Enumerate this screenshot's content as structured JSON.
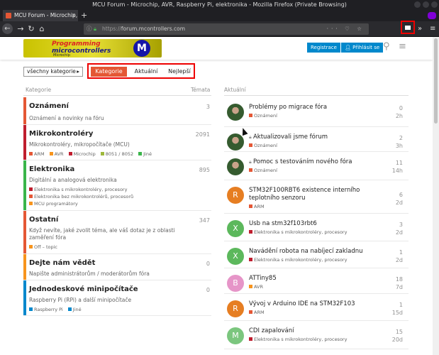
{
  "browser": {
    "window_title": "MCU Forum - Microchip, AVR, Raspberry Pi, elektronika - Mozilla Firefox (Private Browsing)",
    "tab_title": "MCU Forum - Microchip, AVR, R",
    "url_prefix": "https://",
    "url_host": "forum.mcontrollers.com",
    "new_tab": "+",
    "icons": {
      "back": "arrow-left-icon",
      "forward": "arrow-right-icon",
      "reload": "reload-icon",
      "home": "home-icon",
      "lock": "lock-icon",
      "extension": "extension-icon",
      "menu": "hamburger-icon"
    }
  },
  "header": {
    "logo_line1": "Programming",
    "logo_line2": "microcontrollers",
    "logo_small": "Microchip",
    "logo_m": "M",
    "register": "Registrace",
    "login": "Přihlásit se"
  },
  "nav": {
    "dropdown": "všechny kategorie",
    "pills": [
      "Kategorie",
      "Aktuální",
      "Nejlepší"
    ],
    "active": "Kategorie"
  },
  "columns": {
    "categories": "Kategorie",
    "topics": "Témata",
    "latest": "Aktuální"
  },
  "categories": [
    {
      "name": "Oznámení",
      "count": "3",
      "color": "#e45735",
      "desc": "Oznámení a novinky na fóru",
      "subs": []
    },
    {
      "name": "Mikrokontroléry",
      "count": "2091",
      "color": "#bf1e2e",
      "desc": "Mikrokontroléry, mikropočítače (MCU)",
      "subs": [
        {
          "n": "ARM",
          "c": "#e45735"
        },
        {
          "n": "AVR",
          "c": "#f7941d"
        },
        {
          "n": "Microchip",
          "c": "#bf1e2e"
        },
        {
          "n": "8051 / 8052",
          "c": "#9eb83b"
        },
        {
          "n": "Jiné",
          "c": "#3ab54a"
        }
      ]
    },
    {
      "name": "Elektronika",
      "count": "895",
      "color": "#3ab54a",
      "desc": "Digitální a analogová elektronika",
      "subs": [
        {
          "n": "Elektronika s mikrokontroléry, procesory",
          "c": "#bf1e2e"
        },
        {
          "n": "Elektronika bez mikrokontrolérů, procesorů",
          "c": "#e45735"
        },
        {
          "n": "MCU programátory",
          "c": "#f7941d"
        }
      ]
    },
    {
      "name": "Ostatní",
      "count": "347",
      "color": "#e45735",
      "desc": "Když nevíte, jaké zvolit téma, ale váš dotaz je z oblasti zaměření fóra",
      "subs": [
        {
          "n": "Off – topic",
          "c": "#f7941d"
        }
      ]
    },
    {
      "name": "Dejte nám vědět",
      "count": "0",
      "color": "#f7941d",
      "desc": "Napište administrátorům / moderátorům fóra",
      "subs": []
    },
    {
      "name": "Jednodeskové minipočítače",
      "count": "0",
      "color": "#0088cc",
      "desc": "Raspberry Pi (RPi) a další minipočítače",
      "subs": [
        {
          "n": "Raspberry Pi",
          "c": "#0088cc"
        },
        {
          "n": "Jiné",
          "c": "#0088cc"
        }
      ]
    }
  ],
  "topics": [
    {
      "title": "Problémy po migrace fóra",
      "cat": "Oznámení",
      "cat_color": "#e45735",
      "replies": "0",
      "age": "2h",
      "avatar": "photo",
      "letter": "",
      "locked": false
    },
    {
      "title": "Aktualizovali jsme fórum",
      "cat": "Oznámení",
      "cat_color": "#e45735",
      "replies": "2",
      "age": "3h",
      "avatar": "photo",
      "letter": "",
      "locked": true
    },
    {
      "title": "Pomoc s testováním nového fóra",
      "cat": "Oznámení",
      "cat_color": "#e45735",
      "replies": "11",
      "age": "14h",
      "avatar": "photo",
      "letter": "",
      "locked": true
    },
    {
      "title": "STM32F100RBT6 existence interního teplotního senzoru",
      "cat": "ARM",
      "cat_color": "#e45735",
      "replies": "6",
      "age": "2d",
      "avatar": "#e67e22",
      "letter": "R",
      "locked": false
    },
    {
      "title": "Usb na stm32f103rbt6",
      "cat": "Elektronika s mikrokontroléry, procesory",
      "cat_color": "#bf1e2e",
      "replies": "3",
      "age": "2d",
      "avatar": "#5cb85c",
      "letter": "X",
      "locked": false
    },
    {
      "title": "Navádění robota na nabíjecí zakladnu",
      "cat": "Elektronika s mikrokontroléry, procesory",
      "cat_color": "#bf1e2e",
      "replies": "1",
      "age": "2d",
      "avatar": "#5cb85c",
      "letter": "X",
      "locked": false
    },
    {
      "title": "ATTiny85",
      "cat": "AVR",
      "cat_color": "#f7941d",
      "replies": "18",
      "age": "7d",
      "avatar": "#e695c8",
      "letter": "B",
      "locked": false
    },
    {
      "title": "Vývoj v Arduino IDE na STM32F103",
      "cat": "ARM",
      "cat_color": "#e45735",
      "replies": "1",
      "age": "15d",
      "avatar": "#e67e22",
      "letter": "R",
      "locked": false
    },
    {
      "title": "CDI zapalování",
      "cat": "Elektronika s mikrokontroléry, procesory",
      "cat_color": "#bf1e2e",
      "replies": "15",
      "age": "20d",
      "avatar": "#7bc67e",
      "letter": "M",
      "locked": false
    }
  ]
}
